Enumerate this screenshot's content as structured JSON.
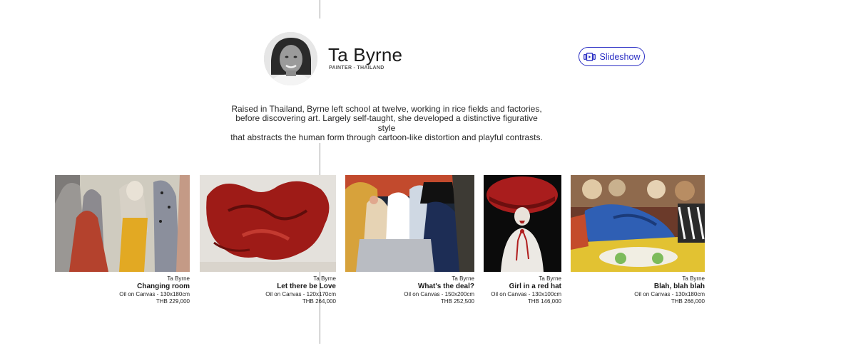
{
  "artist": {
    "name": "Ta Byrne",
    "subtitle": "PAINTER - THAILAND",
    "avatar_icon": "artist-portrait"
  },
  "slideshow": {
    "label": "Slideshow",
    "icon": "slideshow-icon",
    "accent": "#2b2fc4"
  },
  "bio": {
    "line1": "Raised in Thailand, Byrne left school at twelve, working in rice fields and factories,",
    "line2": "before discovering art. Largely self-taught, she developed a distinctive figurative style",
    "line3": "that abstracts the human form through cartoon-like distortion and playful contrasts."
  },
  "artworks": [
    {
      "artist": "Ta Byrne",
      "title": "Changing room",
      "medium": "Oil on Canvas - 130x180cm",
      "price": "THB 229,000"
    },
    {
      "artist": "Ta Byrne",
      "title": "Let there be Love",
      "medium": "Oil on Canvas - 120x170cm",
      "price": "THB 264,000"
    },
    {
      "artist": "Ta Byrne",
      "title": "What's the deal?",
      "medium": "Oil on Canvas - 150x200cm",
      "price": "THB 252,500"
    },
    {
      "artist": "Ta Byrne",
      "title": "Girl in a red hat",
      "medium": "Oil on Canvas - 130x100cm",
      "price": "THB 146,000"
    },
    {
      "artist": "Ta Byrne",
      "title": "Blah, blah blah",
      "medium": "Oil on Canvas - 130x180cm",
      "price": "THB 266,000"
    }
  ]
}
